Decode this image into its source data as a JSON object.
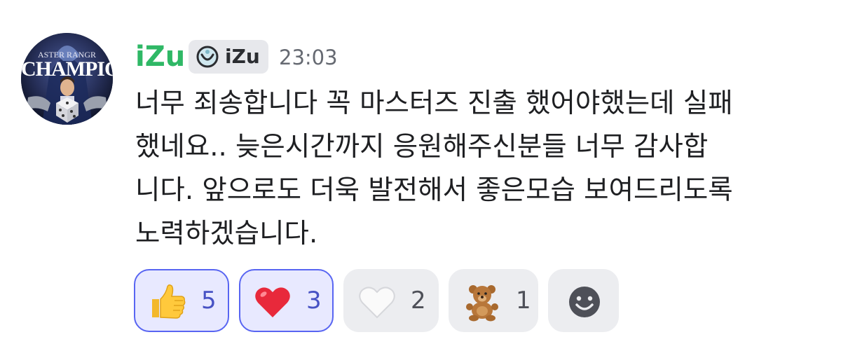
{
  "author": {
    "username": "iZu",
    "tag_label": "iZu",
    "timestamp": "23:03",
    "username_color": "#2fb866",
    "avatar_text_top": "ASTER RANGR",
    "avatar_text_main": "CHAMPION"
  },
  "message": {
    "text": "너무 죄송합니다 꼭 마스터즈 진출 했어야했는데 실패\n했네요.. 늦은시간까지 응원해주신분들 너무 감사합\n니다. 앞으로도 더욱 발전해서 좋은모습 보여드리도록\n노력하겠습니다."
  },
  "reactions": [
    {
      "emoji": "thumbs-up",
      "count": "5",
      "selected": true
    },
    {
      "emoji": "red-heart",
      "count": "3",
      "selected": true
    },
    {
      "emoji": "white-heart",
      "count": "2",
      "selected": false
    },
    {
      "emoji": "teddy-bear",
      "count": "1",
      "selected": false
    }
  ],
  "add_reaction": {
    "icon": "smiley-face-icon"
  },
  "colors": {
    "accent": "#5865f2",
    "selected_bg": "#e8e9ff",
    "reaction_bg": "#ecedf0",
    "text": "#1e1f22",
    "timestamp": "#666a72"
  }
}
